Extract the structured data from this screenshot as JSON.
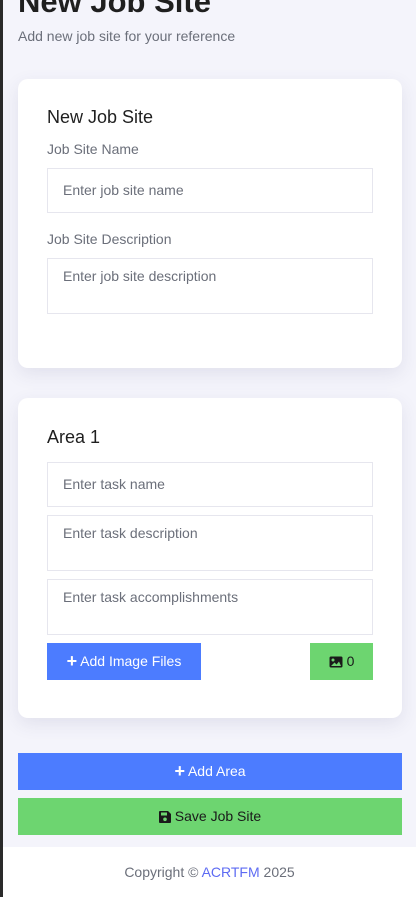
{
  "header": {
    "title": "New Job Site",
    "subtitle": "Add new job site for your reference"
  },
  "site_card": {
    "title": "New Job Site",
    "name_label": "Job Site Name",
    "name_placeholder": "Enter job site name",
    "description_label": "Job Site Description",
    "description_placeholder": "Enter job site description"
  },
  "area_card": {
    "title": "Area 1",
    "task_name_placeholder": "Enter task name",
    "task_description_placeholder": "Enter task description",
    "task_accomplishments_placeholder": "Enter task accomplishments",
    "add_images_label": "Add Image Files",
    "image_count": "0"
  },
  "actions": {
    "add_area_label": "Add Area",
    "save_label": "Save Job Site"
  },
  "footer": {
    "prefix": "Copyright © ",
    "brand": "ACRTFM",
    "year": " 2025"
  },
  "icons": {
    "plus": "plus-icon",
    "image": "image-icon",
    "save": "floppy-disk-icon"
  },
  "colors": {
    "primary_blue": "#4c7cff",
    "success_green": "#6dd570",
    "page_background": "#f4f4fb",
    "brand_link": "#5d6bf3"
  }
}
